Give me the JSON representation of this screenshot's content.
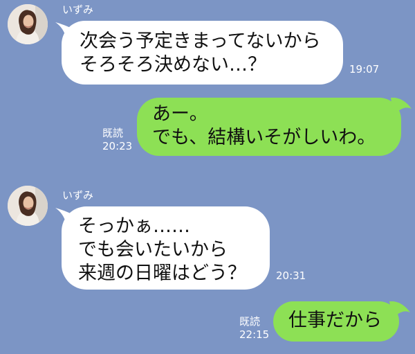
{
  "messages": [
    {
      "side": "in",
      "sender": "いずみ",
      "lines": [
        "次会う予定きまってないから",
        "そろそろ決めない…？"
      ],
      "time": "19:07"
    },
    {
      "side": "out",
      "read": "既読",
      "lines": [
        "あー。",
        "でも、結構いそがしいわ。"
      ],
      "time": "20:23"
    },
    {
      "side": "in",
      "sender": "いずみ",
      "lines": [
        "そっかぁ……",
        "でも会いたいから",
        "来週の日曜はどう？"
      ],
      "time": "20:31"
    },
    {
      "side": "out",
      "read": "既読",
      "lines": [
        "仕事だから"
      ],
      "time": "22:15"
    }
  ],
  "colors": {
    "background": "#7c95c5",
    "incoming_bubble": "#ffffff",
    "outgoing_bubble": "#8de055",
    "meta_text": "#ffffff"
  }
}
